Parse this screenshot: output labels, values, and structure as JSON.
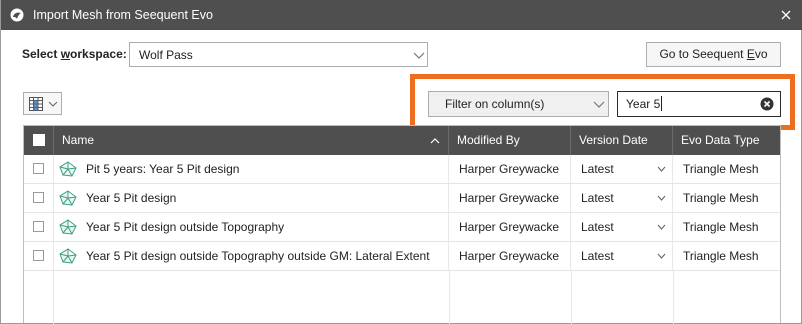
{
  "window": {
    "title": "Import Mesh from Seequent Evo"
  },
  "workspace": {
    "label_prefix": "Select ",
    "label_accel": "w",
    "label_suffix": "orkspace:",
    "value": "Wolf Pass"
  },
  "goto_button": {
    "label_prefix": "Go to Seequent ",
    "label_accel": "E",
    "label_suffix": "vo"
  },
  "filter": {
    "column_select": "Filter on column(s)",
    "search_value": "Year 5"
  },
  "table": {
    "headers": [
      "Name",
      "Modified By",
      "Version Date",
      "Evo Data Type"
    ],
    "rows": [
      {
        "name": "Pit 5 years: Year 5 Pit design",
        "modified_by": "Harper Greywacke",
        "version": "Latest",
        "type": "Triangle Mesh"
      },
      {
        "name": "Year 5 Pit design",
        "modified_by": "Harper Greywacke",
        "version": "Latest",
        "type": "Triangle Mesh"
      },
      {
        "name": "Year 5 Pit design outside Topography",
        "modified_by": "Harper Greywacke",
        "version": "Latest",
        "type": "Triangle Mesh"
      },
      {
        "name": "Year 5 Pit design outside Topography outside GM: Lateral Extent",
        "modified_by": "Harper Greywacke",
        "version": "Latest",
        "type": "Triangle Mesh"
      }
    ]
  },
  "colors": {
    "titlebar": "#4f4f4f",
    "highlight": "#ef6d1f",
    "mesh_icon": "#3f9e84"
  }
}
